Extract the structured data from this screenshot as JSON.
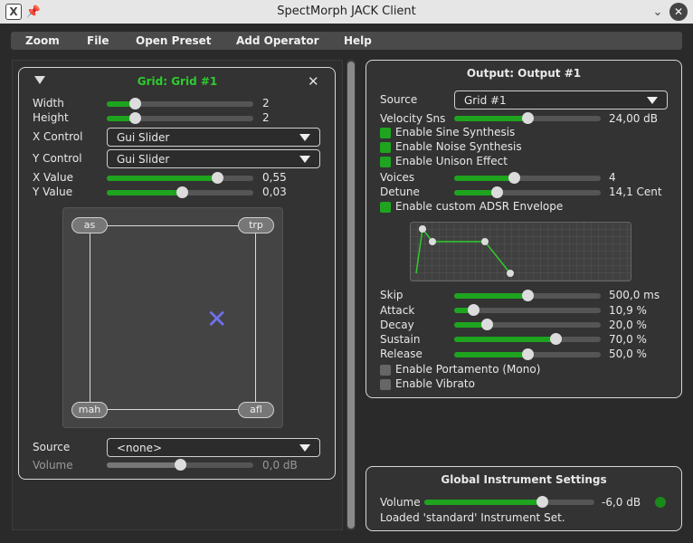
{
  "window": {
    "title": "SpectMorph JACK Client"
  },
  "menu": {
    "items": [
      "Zoom",
      "File",
      "Open Preset",
      "Add Operator",
      "Help"
    ]
  },
  "grid": {
    "title": "Grid: Grid #1",
    "title_color": "#2ecc2e",
    "width": {
      "label": "Width",
      "value": "2",
      "level": 0.19
    },
    "height": {
      "label": "Height",
      "value": "2",
      "level": 0.19
    },
    "x_control": {
      "label": "X Control",
      "value": "Gui Slider"
    },
    "y_control": {
      "label": "Y Control",
      "value": "Gui Slider"
    },
    "x_value": {
      "label": "X Value",
      "value": "0,55",
      "level": 0.755
    },
    "y_value": {
      "label": "Y Value",
      "value": "0,03",
      "level": 0.515
    },
    "corners": {
      "top_left": "as",
      "top_right": "trp",
      "bottom_left": "mah",
      "bottom_right": "afl"
    },
    "source": {
      "label": "Source",
      "value": "<none>"
    },
    "volume": {
      "label": "Volume",
      "value": "0,0 dB",
      "level": 0.5
    }
  },
  "output": {
    "title": "Output: Output #1",
    "source": {
      "label": "Source",
      "value": "Grid #1"
    },
    "velocity": {
      "label": "Velocity Sns",
      "value": "24,00 dB",
      "level": 0.5
    },
    "checks_top": [
      {
        "label": "Enable Sine Synthesis",
        "checked": true
      },
      {
        "label": "Enable Noise Synthesis",
        "checked": true
      },
      {
        "label": "Enable Unison Effect",
        "checked": true
      }
    ],
    "voices": {
      "label": "Voices",
      "value": "4",
      "level": 0.41
    },
    "detune": {
      "label": "Detune",
      "value": "14,1 Cent",
      "level": 0.29
    },
    "adsr_check": {
      "label": "Enable custom ADSR Envelope",
      "checked": true
    },
    "skip": {
      "label": "Skip",
      "value": "500,0 ms",
      "level": 0.5
    },
    "attack": {
      "label": "Attack",
      "value": "10,9 %",
      "level": 0.13
    },
    "decay": {
      "label": "Decay",
      "value": "20,0 %",
      "level": 0.22
    },
    "sustain": {
      "label": "Sustain",
      "value": "70,0 %",
      "level": 0.69
    },
    "release": {
      "label": "Release",
      "value": "50,0 %",
      "level": 0.5
    },
    "checks_bottom": [
      {
        "label": "Enable Portamento (Mono)",
        "checked": false
      },
      {
        "label": "Enable Vibrato",
        "checked": false
      }
    ]
  },
  "global": {
    "title": "Global Instrument Settings",
    "volume": {
      "label": "Volume",
      "value": "-6,0 dB",
      "level": 0.69
    },
    "status": "Loaded 'standard' Instrument Set.",
    "led_color": "#1a8a1a"
  },
  "icons": {
    "app": "app-x-icon",
    "pin": "pin-icon",
    "minimize": "chevron-down-icon",
    "close": "close-icon",
    "collapse": "triangle-down-icon",
    "remove": "close-icon"
  }
}
